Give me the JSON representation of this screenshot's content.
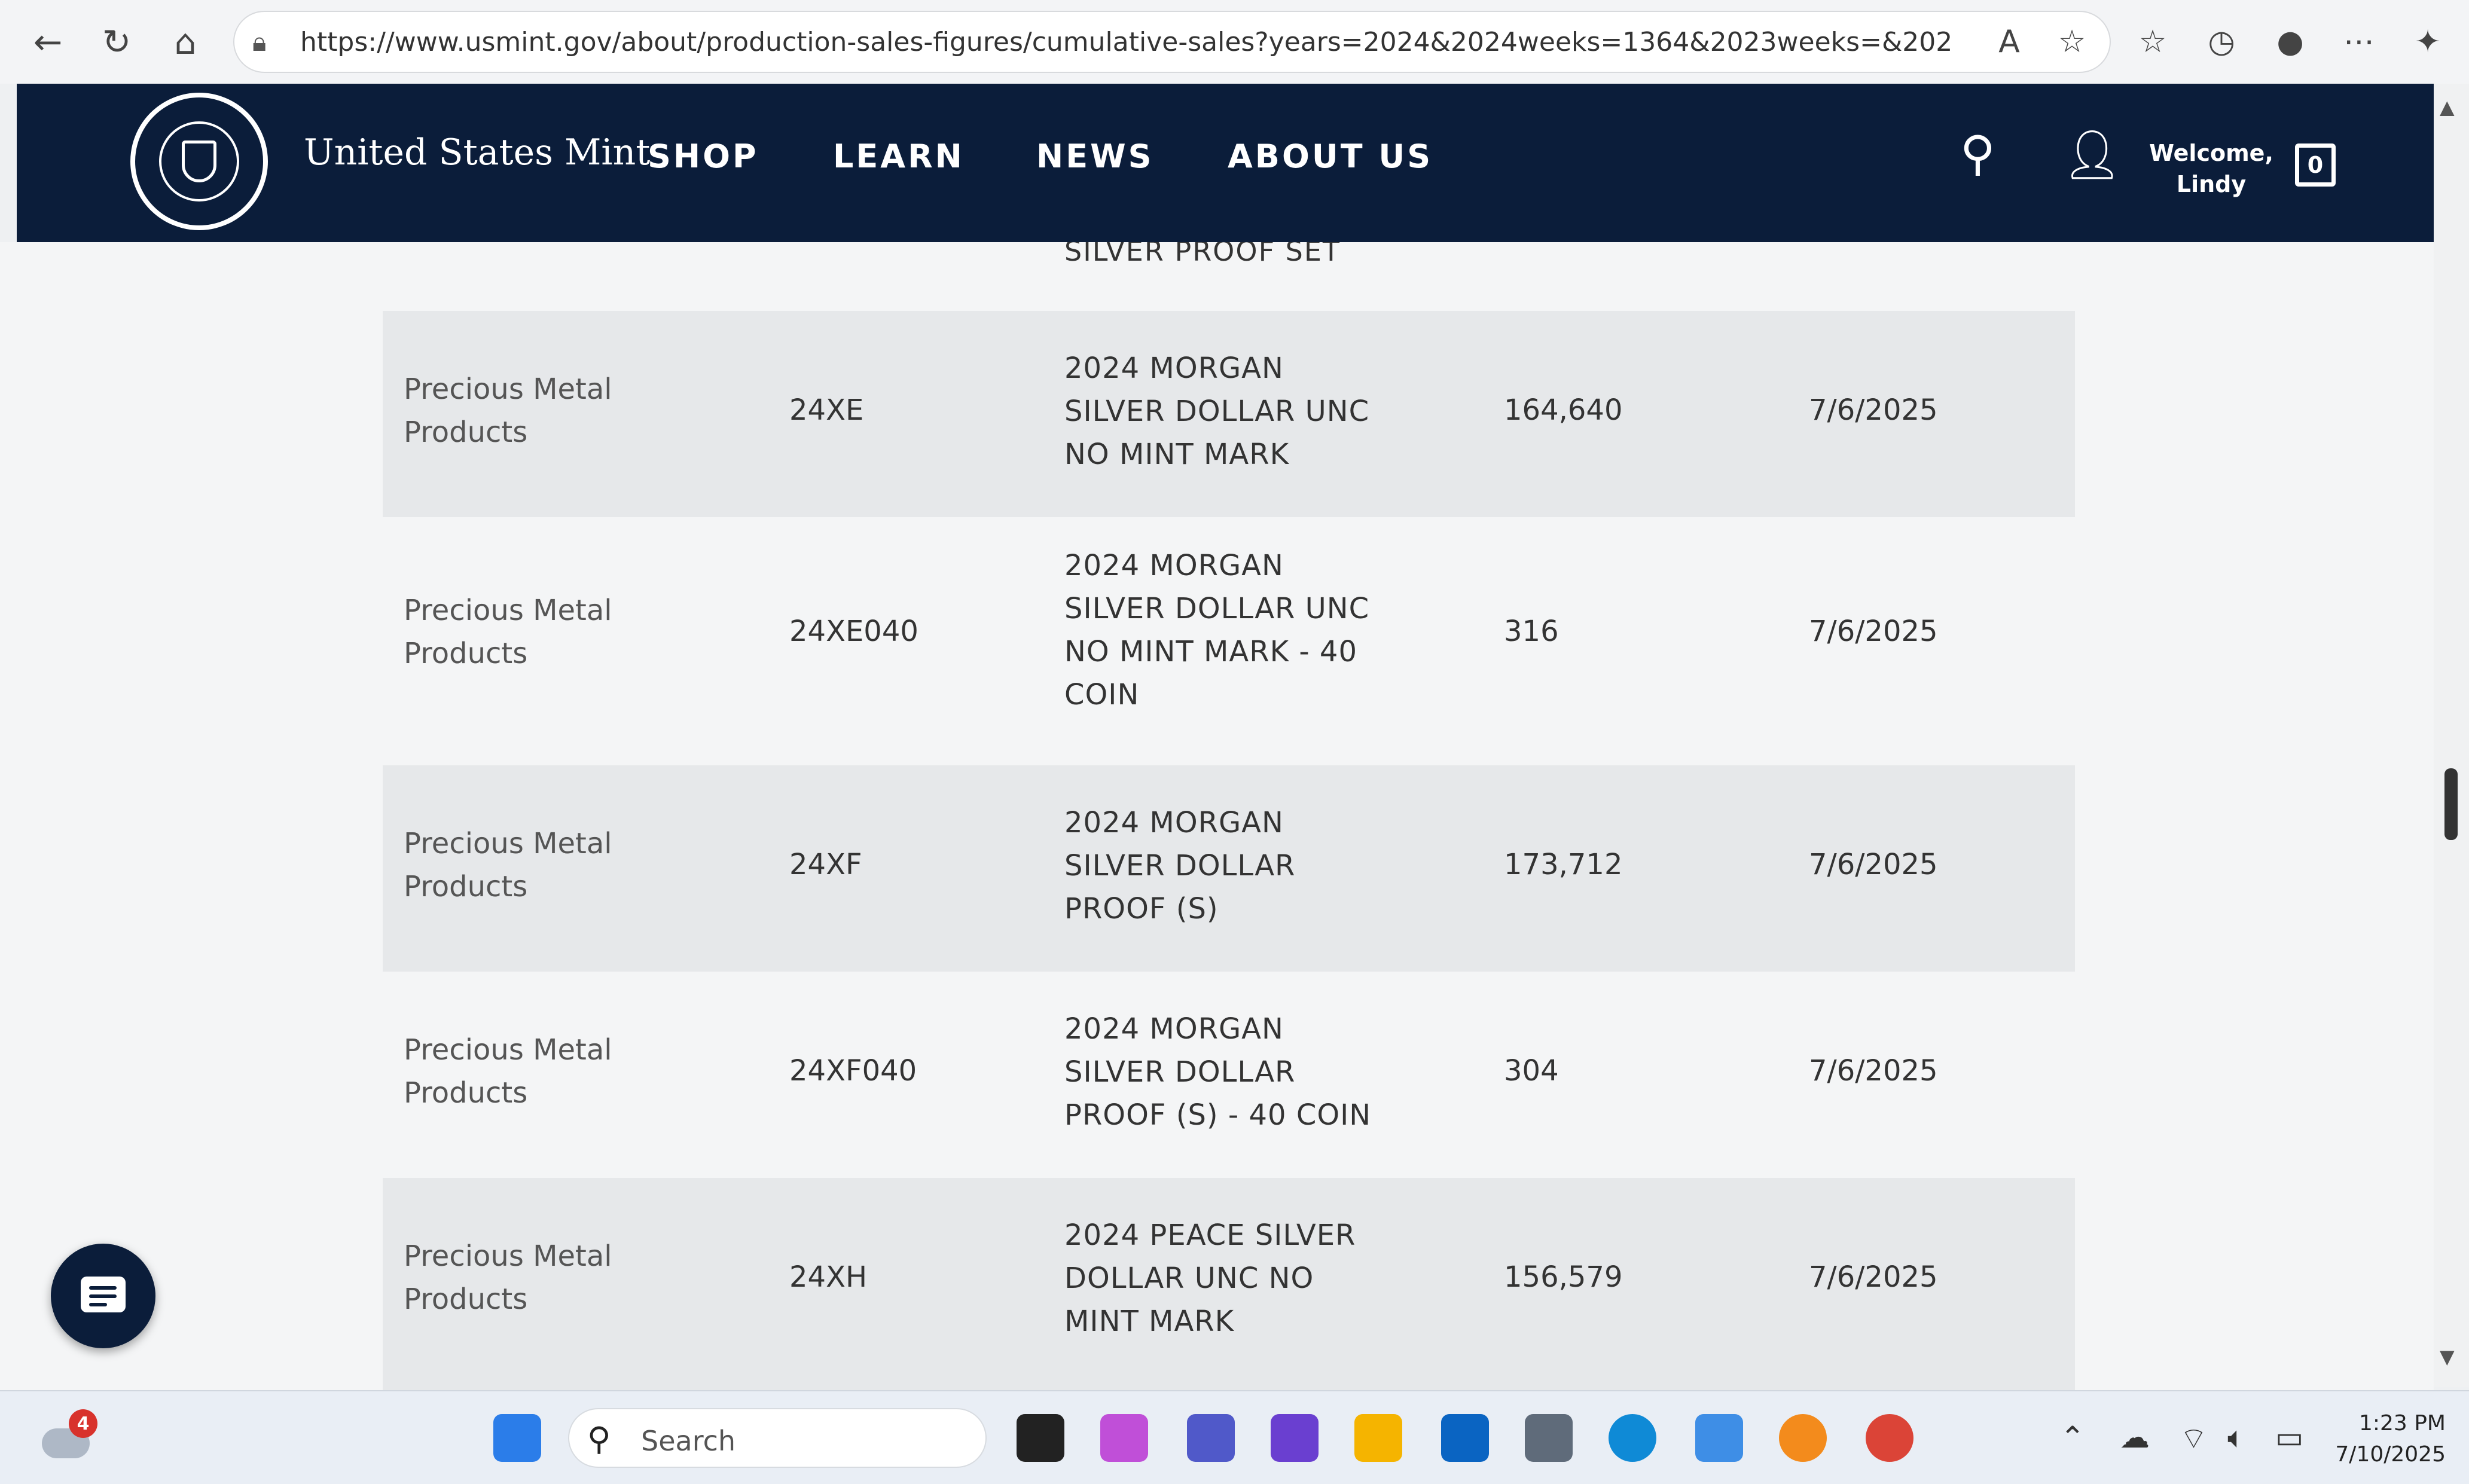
{
  "browser": {
    "url": "https://www.usmint.gov/about/production-sales-figures/cumulative-sales?years=2024&2024weeks=1364&2023weeks=&2022weeks=&20..."
  },
  "header": {
    "brand": "United States Mint",
    "menu": [
      "SHOP",
      "LEARN",
      "NEWS",
      "ABOUT US"
    ],
    "welcome_line1": "Welcome,",
    "welcome_line2": "Lindy",
    "cart_count": "0"
  },
  "partial_row_text": "SILVER PROOF SET",
  "rows": [
    {
      "category_line1": "Precious Metal",
      "category_line2": "Products",
      "code": "24XE",
      "desc": [
        "2024 MORGAN",
        "SILVER DOLLAR UNC",
        "NO MINT MARK"
      ],
      "qty": "164,640",
      "date": "7/6/2025"
    },
    {
      "category_line1": "Precious Metal",
      "category_line2": "Products",
      "code": "24XE040",
      "desc": [
        "2024 MORGAN",
        "SILVER DOLLAR UNC",
        "NO MINT MARK - 40",
        "COIN"
      ],
      "qty": "316",
      "date": "7/6/2025"
    },
    {
      "category_line1": "Precious Metal",
      "category_line2": "Products",
      "code": "24XF",
      "desc": [
        "2024 MORGAN",
        "SILVER DOLLAR",
        "PROOF (S)"
      ],
      "qty": "173,712",
      "date": "7/6/2025"
    },
    {
      "category_line1": "Precious Metal",
      "category_line2": "Products",
      "code": "24XF040",
      "desc": [
        "2024 MORGAN",
        "SILVER DOLLAR",
        "PROOF (S) - 40 COIN"
      ],
      "qty": "304",
      "date": "7/6/2025"
    },
    {
      "category_line1": "Precious Metal",
      "category_line2": "Products",
      "code": "24XH",
      "desc": [
        "2024 PEACE SILVER",
        "DOLLAR UNC NO",
        "MINT MARK"
      ],
      "qty": "156,579",
      "date": "7/6/2025"
    }
  ],
  "taskbar": {
    "search_placeholder": "Search",
    "notification_count": "4",
    "time": "1:23 PM",
    "date": "7/10/2025"
  },
  "colors": {
    "header_bg": "#0b1d3a",
    "row_shade": "#e6e8ea",
    "page_bg": "#f4f5f6"
  }
}
